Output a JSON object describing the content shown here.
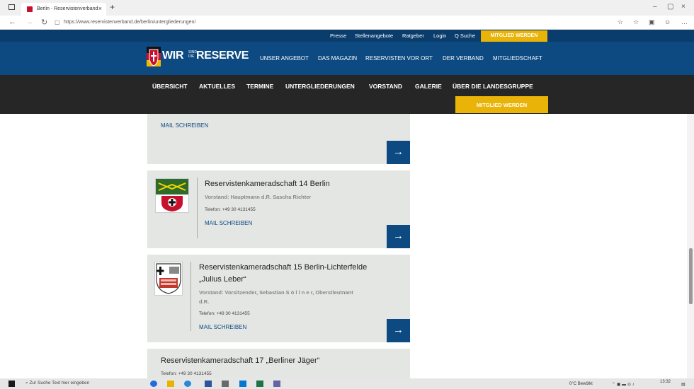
{
  "browser": {
    "tab_title": "Berlin - Reservistenverband",
    "tab_close": "×",
    "new_tab": "+",
    "url": "https://www.reservistenverband.de/berlin/untergliederungen/",
    "win_min": "–",
    "win_max": "▢",
    "win_close": "×"
  },
  "topnav": {
    "items": [
      "Presse",
      "Stellenangebote",
      "Ratgeber",
      "Login"
    ],
    "search": "Q Suche",
    "cta": "MITGLIED WERDEN"
  },
  "logo": {
    "main": "WIR",
    "small_top": "SIND",
    "small_bottom": "DIE",
    "tail": "RESERVE"
  },
  "mainnav": [
    "UNSER ANGEBOT",
    "DAS MAGAZIN",
    "RESERVISTEN VOR ORT",
    "DER VERBAND",
    "MITGLIEDSCHAFT"
  ],
  "subnav": {
    "items": [
      "ÜBERSICHT",
      "AKTUELLES",
      "TERMINE",
      "UNTERGLIEDERUNGEN",
      "VORSTAND",
      "GALERIE",
      "ÜBER DIE LANDESGRUPPE"
    ],
    "cta": "MITGLIED WERDEN"
  },
  "cards": [
    {
      "mail": "MAIL SCHREIBEN",
      "arrow": "→"
    },
    {
      "title": "Reservistenkameradschaft 14 Berlin",
      "vorstand": "Vorstand: Hauptmann d.R. Sascha Richter",
      "telefon": "Telefon: +49 30 4131455",
      "mail": "MAIL SCHREIBEN",
      "arrow": "→"
    },
    {
      "title_line1": "Reservistenkameradschaft 15 Berlin-Lichterfelde",
      "title_line2": "„Julius Leber“",
      "vorstand_line1": "Vorstand: Vorsitzender, Sebastian S ö l l n e r, Oberstleutnant",
      "vorstand_line2": "d.R.",
      "telefon": "Telefon: +49 30 4131455",
      "mail": "MAIL SCHREIBEN",
      "arrow": "→"
    },
    {
      "title": "Reservistenkameradschaft 17 „Berliner Jäger“",
      "telefon": "Telefon: +49 30 4131455"
    }
  ],
  "taskbar": {
    "search_placeholder": "Zur Suche Text hier eingeben",
    "weather": "0°C Bewölkt",
    "time": "13:32"
  },
  "colors": {
    "navy": "#0d4a82",
    "dark_navy": "#0a3d6b",
    "yellow": "#eab308",
    "card_bg": "#e4e6e3",
    "subnav_bg": "#262626"
  }
}
